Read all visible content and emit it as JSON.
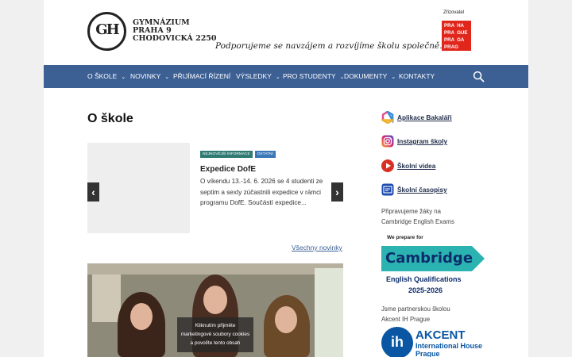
{
  "header": {
    "logo_mono": "GH",
    "logo_lines": [
      "GYMNÁZIUM",
      "PRAHA 9",
      "CHODOVICKÁ 2250"
    ],
    "tagline": "Podporujeme se navzájem  a rozvíjíme školu společně.",
    "zrizovatel_label": "Zřizovatel",
    "prague_logo_rows": [
      [
        "PRA",
        "HA"
      ],
      [
        "PRA",
        "GUE"
      ],
      [
        "PRA",
        "GA"
      ],
      [
        "PRAG",
        ""
      ]
    ]
  },
  "nav": {
    "items": [
      {
        "label": "O ŠKOLE",
        "dropdown": "⌄"
      },
      {
        "label": "NOVINKY",
        "dropdown": "⌄"
      },
      {
        "label": "PŘIJÍMACÍ ŘÍZENÍ",
        "dropdown": ""
      },
      {
        "label": "VÝSLEDKY",
        "dropdown": "⌄"
      },
      {
        "label": "PRO STUDENTY",
        "dropdown": "⌄"
      },
      {
        "label": "DOKUMENTY",
        "dropdown": "⌄"
      },
      {
        "label": "KONTAKTY",
        "dropdown": ""
      }
    ],
    "search_icon": "search-icon"
  },
  "main": {
    "page_title": "O škole",
    "slider": {
      "prev_label": "‹",
      "next_label": "›",
      "tags": [
        "NEJNOVĚJŠÍ INFORMACE",
        "OSTATNÍ"
      ],
      "post_title": "Expedice DofE",
      "post_excerpt": "O víkendu 13.-14. 6. 2026 se 4 studenti ze septim a sexty zúčastnili expedice v rámci programu DofE. Součástí expedice..."
    },
    "all_news_label": "Všechny novinky",
    "cookie_notice": [
      "Kliknutím přijměte",
      "marketingové soubory cookies",
      "a povolíte tento obsah"
    ]
  },
  "sidebar": {
    "links": [
      {
        "label": "Aplikace Bakaláři",
        "icon": "bakalari-icon"
      },
      {
        "label": "Instagram školy",
        "icon": "instagram-icon"
      },
      {
        "label": "Školní videa",
        "icon": "play-icon"
      },
      {
        "label": "Školní časopisy",
        "icon": "magazine-icon"
      }
    ],
    "cambridge_intro": [
      "Připravujeme žáky na",
      "Cambridge English Exams"
    ],
    "cambridge_badge": {
      "prepare": "We prepare for",
      "word": "Cambridge",
      "qualifications": "English Qualifications",
      "years": "2025-2026"
    },
    "partner_intro": [
      "Jsme partnerskou školou",
      "Akcent IH Prague"
    ],
    "akcent": {
      "logo_text": "ih",
      "name": "AKCENT",
      "sub1": "International House",
      "sub2": "Prague"
    }
  },
  "colors": {
    "nav_bg": "#3c5f94",
    "prague_red": "#e1261c",
    "cambridge_teal": "#2bb3b1",
    "akcent_blue": "#0a56a3"
  }
}
